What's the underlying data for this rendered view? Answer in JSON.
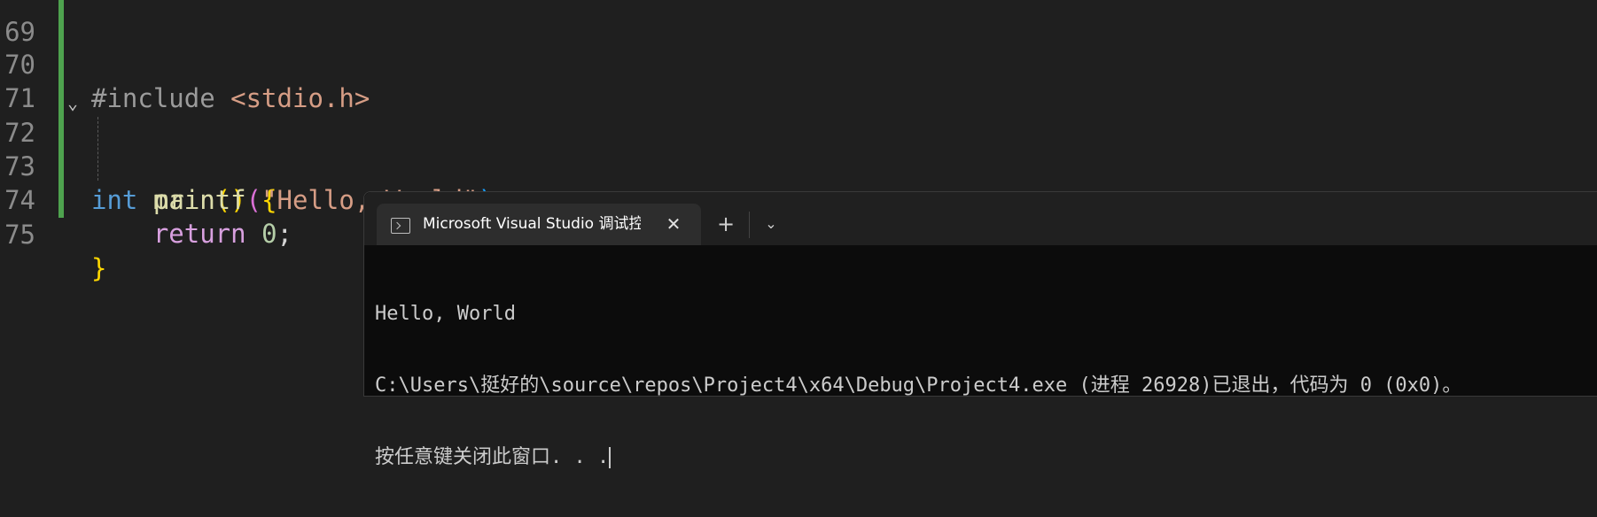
{
  "editor": {
    "lines": [
      {
        "number": "69",
        "tokens": []
      },
      {
        "number": "70",
        "tokens": [
          [
            "#include ",
            "pre"
          ],
          [
            "<stdio.h>",
            "inc"
          ]
        ]
      },
      {
        "number": "71",
        "tokens": []
      },
      {
        "number": "72",
        "tokens": [
          [
            "int",
            "kw"
          ],
          [
            " ",
            "punc"
          ],
          [
            "main",
            "fn"
          ],
          [
            "()",
            "paren"
          ],
          [
            " ",
            "punc"
          ],
          [
            "{",
            "paren"
          ]
        ]
      },
      {
        "number": "73",
        "tokens": [
          [
            "    ",
            "punc"
          ],
          [
            "printf",
            "fn"
          ],
          [
            "(",
            "paren2"
          ],
          [
            "\"Hello, World\"",
            "str"
          ],
          [
            ")",
            "blue"
          ],
          [
            ";",
            "punc"
          ]
        ]
      },
      {
        "number": "74",
        "tokens": [
          [
            "    ",
            "punc"
          ],
          [
            "return",
            "ctrl"
          ],
          [
            " ",
            "punc"
          ],
          [
            "0",
            "num"
          ],
          [
            ";",
            "punc"
          ]
        ]
      },
      {
        "number": "75",
        "tokens": [
          [
            "}",
            "paren"
          ]
        ]
      }
    ],
    "fold_icon": "chevron-down-icon",
    "change_bar_color": "#4ea24e"
  },
  "terminal": {
    "tab_title": "Microsoft Visual Studio 调试控制台",
    "tab_icon": "console-icon",
    "close_glyph": "✕",
    "new_tab_glyph": "+",
    "dropdown_glyph": "⌄",
    "output": [
      "Hello, World",
      "C:\\Users\\挺好的\\source\\repos\\Project4\\x64\\Debug\\Project4.exe (进程 26928)已退出，代码为 0 (0x0)。",
      "按任意键关闭此窗口. . ."
    ]
  }
}
